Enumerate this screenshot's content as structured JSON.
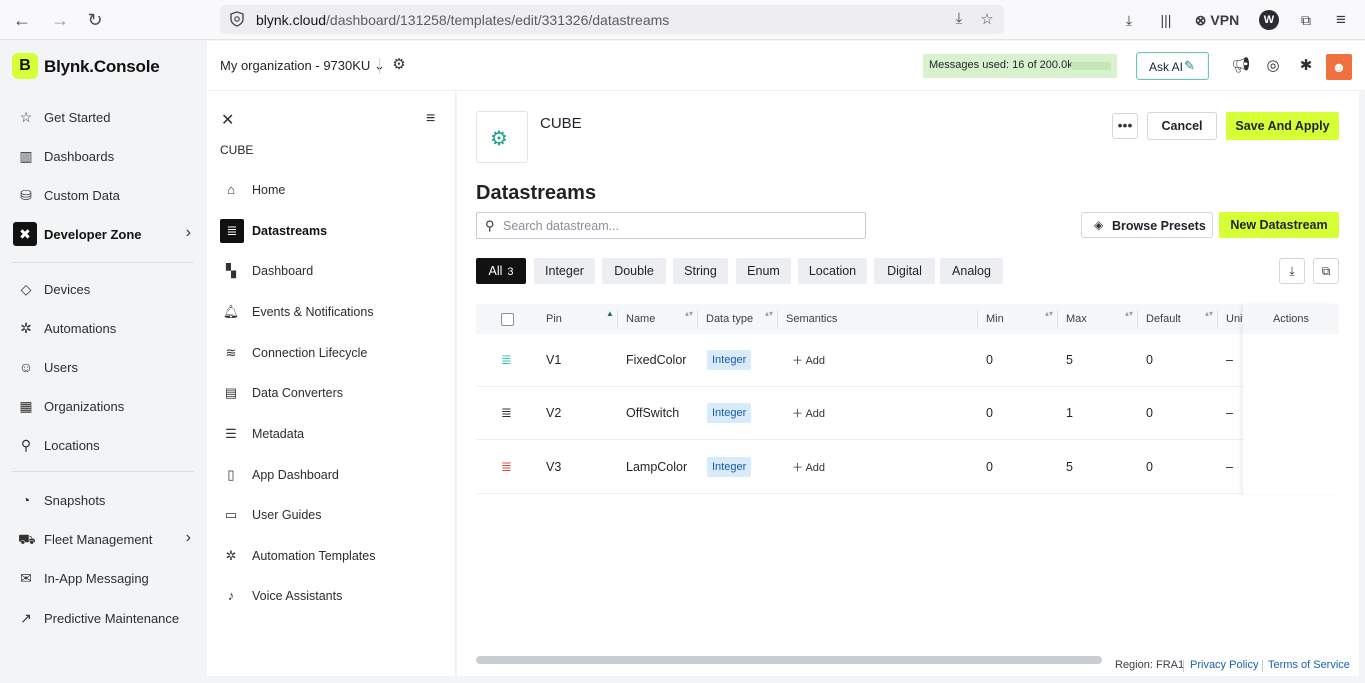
{
  "browser": {
    "url_host": "blynk.cloud",
    "url_path": "/dashboard/131258/templates/edit/331326/datastreams",
    "vpn_label": "VPN",
    "profile_letter": "W"
  },
  "brand": {
    "logo_letter": "B",
    "name": "Blynk.Console"
  },
  "sidebar": {
    "items": [
      {
        "label": "Get Started",
        "icon": "star-icon"
      },
      {
        "label": "Dashboards",
        "icon": "bar-chart-icon"
      },
      {
        "label": "Custom Data",
        "icon": "database-icon"
      },
      {
        "label": "Developer Zone",
        "icon": "developer-zone-icon"
      },
      {
        "label": "Devices",
        "icon": "cube-icon"
      },
      {
        "label": "Automations",
        "icon": "automation-icon"
      },
      {
        "label": "Users",
        "icon": "users-icon"
      },
      {
        "label": "Organizations",
        "icon": "building-icon"
      },
      {
        "label": "Locations",
        "icon": "location-pin-icon"
      },
      {
        "label": "Snapshots",
        "icon": "snapshot-icon"
      },
      {
        "label": "Fleet Management",
        "icon": "truck-icon"
      },
      {
        "label": "In-App Messaging",
        "icon": "message-icon"
      },
      {
        "label": "Predictive Maintenance",
        "icon": "trend-chart-icon"
      }
    ]
  },
  "header": {
    "org_name": "My organization - 9730KU",
    "messages_used": "Messages used: 16 of 200.0k",
    "ask_ai": "Ask AI"
  },
  "template_nav": {
    "template_name": "CUBE",
    "items": [
      {
        "label": "Home"
      },
      {
        "label": "Datastreams"
      },
      {
        "label": "Dashboard"
      },
      {
        "label": "Events & Notifications"
      },
      {
        "label": "Connection Lifecycle"
      },
      {
        "label": "Data Converters"
      },
      {
        "label": "Metadata"
      },
      {
        "label": "App Dashboard"
      },
      {
        "label": "User Guides"
      },
      {
        "label": "Automation Templates"
      },
      {
        "label": "Voice Assistants"
      }
    ]
  },
  "main": {
    "product_title": "CUBE",
    "more_label": "•••",
    "cancel_label": "Cancel",
    "save_label": "Save And Apply",
    "page_title": "Datastreams",
    "search_placeholder": "Search datastream...",
    "browse_presets_label": "Browse Presets",
    "new_datastream_label": "New Datastream",
    "filters": [
      {
        "label": "All",
        "count": "3"
      },
      {
        "label": "Integer"
      },
      {
        "label": "Double"
      },
      {
        "label": "String"
      },
      {
        "label": "Enum"
      },
      {
        "label": "Location"
      },
      {
        "label": "Digital"
      },
      {
        "label": "Analog"
      }
    ],
    "columns": {
      "pin": "Pin",
      "name": "Name",
      "data_type": "Data type",
      "semantics": "Semantics",
      "min": "Min",
      "max": "Max",
      "default": "Default",
      "units": "Unit",
      "actions": "Actions"
    },
    "rows": [
      {
        "pin": "V1",
        "name": "FixedColor",
        "type": "Integer",
        "semantics": "Add",
        "min": "0",
        "max": "5",
        "default": "0",
        "units": "–",
        "icon_color": "#3bc3b8"
      },
      {
        "pin": "V2",
        "name": "OffSwitch",
        "type": "Integer",
        "semantics": "Add",
        "min": "0",
        "max": "1",
        "default": "0",
        "units": "–",
        "icon_color": "#2a2d33"
      },
      {
        "pin": "V3",
        "name": "LampColor",
        "type": "Integer",
        "semantics": "Add",
        "min": "0",
        "max": "5",
        "default": "0",
        "units": "–",
        "icon_color": "#e0443b"
      }
    ]
  },
  "footer": {
    "region": "Region: FRA1",
    "privacy": "Privacy Policy",
    "terms": "Terms of Service"
  },
  "colors": {
    "accent": "#d7ff35",
    "badge_bg": "#d8ebfb",
    "badge_text": "#1b5aa6"
  }
}
